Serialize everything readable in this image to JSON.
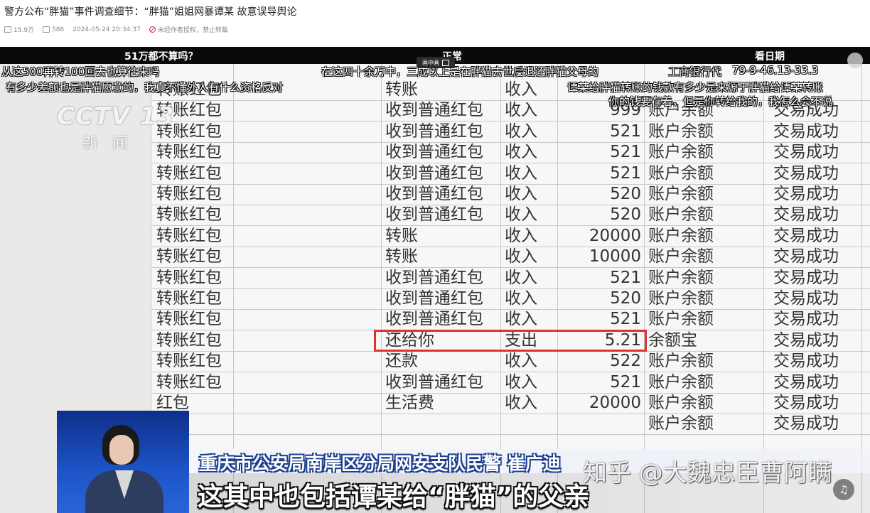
{
  "article": {
    "title": "警方公布“胖猫”事件调查细节：“胖猫”姐姐网暴谭某 故意误导舆论",
    "views": "15.9万",
    "comments": "586",
    "timestamp": "2024-05-24 20:34:37",
    "copyright": "未经作者授权，禁止转载"
  },
  "video": {
    "top_labels": [
      "51万都不算吗？",
      "正常",
      "看日期"
    ],
    "pip_label": "画中画",
    "logo": "CCTV 13",
    "logo_sub": "新闻",
    "danmaku": [
      "从这500再转100回去也算往来吗",
      "在这四十余万中，三成以上是在胖猫去世后退还胖猫父母的",
      "有多少差额也是胖猫愿意的，我真不懂外人有什么资格反对",
      "谭某给胖猫转账的钱款有多少是来源于胖猫给谭某转账",
      "你的钱要存着，但是你转给我的，我怎么会不说",
      "工商银行代",
      "79-9-46.13-33.3"
    ],
    "table": {
      "rows": [
        {
          "type": "转账红包",
          "desc": "转账",
          "dir": "收入",
          "amount": "",
          "acct": "",
          "status": ""
        },
        {
          "type": "转账红包",
          "desc": "收到普通红包",
          "dir": "收入",
          "amount": "999",
          "acct": "账户余额",
          "status": "交易成功"
        },
        {
          "type": "转账红包",
          "desc": "收到普通红包",
          "dir": "收入",
          "amount": "521",
          "acct": "账户余额",
          "status": "交易成功"
        },
        {
          "type": "转账红包",
          "desc": "收到普通红包",
          "dir": "收入",
          "amount": "521",
          "acct": "账户余额",
          "status": "交易成功"
        },
        {
          "type": "转账红包",
          "desc": "收到普通红包",
          "dir": "收入",
          "amount": "521",
          "acct": "账户余额",
          "status": "交易成功"
        },
        {
          "type": "转账红包",
          "desc": "收到普通红包",
          "dir": "收入",
          "amount": "520",
          "acct": "账户余额",
          "status": "交易成功"
        },
        {
          "type": "转账红包",
          "desc": "收到普通红包",
          "dir": "收入",
          "amount": "520",
          "acct": "账户余额",
          "status": "交易成功"
        },
        {
          "type": "转账红包",
          "desc": "转账",
          "dir": "收入",
          "amount": "20000",
          "acct": "账户余额",
          "status": "交易成功"
        },
        {
          "type": "转账红包",
          "desc": "转账",
          "dir": "收入",
          "amount": "10000",
          "acct": "账户余额",
          "status": "交易成功"
        },
        {
          "type": "转账红包",
          "desc": "收到普通红包",
          "dir": "收入",
          "amount": "521",
          "acct": "账户余额",
          "status": "交易成功"
        },
        {
          "type": "转账红包",
          "desc": "收到普通红包",
          "dir": "收入",
          "amount": "520",
          "acct": "账户余额",
          "status": "交易成功"
        },
        {
          "type": "转账红包",
          "desc": "收到普通红包",
          "dir": "收入",
          "amount": "521",
          "acct": "账户余额",
          "status": "交易成功"
        },
        {
          "type": "转账红包",
          "desc": "还给你",
          "dir": "支出",
          "amount": "5.21",
          "acct": "余额宝",
          "status": "交易成功"
        },
        {
          "type": "转账红包",
          "desc": "还款",
          "dir": "收入",
          "amount": "522",
          "acct": "账户余额",
          "status": "交易成功"
        },
        {
          "type": "转账红包",
          "desc": "收到普通红包",
          "dir": "收入",
          "amount": "521",
          "acct": "账户余额",
          "status": "交易成功"
        },
        {
          "type": "红包",
          "desc": "生活费",
          "dir": "收入",
          "amount": "20000",
          "acct": "账户余额",
          "status": "交易成功"
        },
        {
          "type": "",
          "desc": "",
          "dir": "",
          "amount": "",
          "acct": "账户余额",
          "status": "交易成功"
        }
      ],
      "highlight_row": 12,
      "highlight_color": "#e03030"
    },
    "name_caption": "重庆市公安局南岸区分局网安支队民警  崔广迪",
    "subtitle": "这其中也包括谭某给“胖猫”的父亲",
    "watermark": "知乎 @大魏忠臣曹阿瞒"
  }
}
